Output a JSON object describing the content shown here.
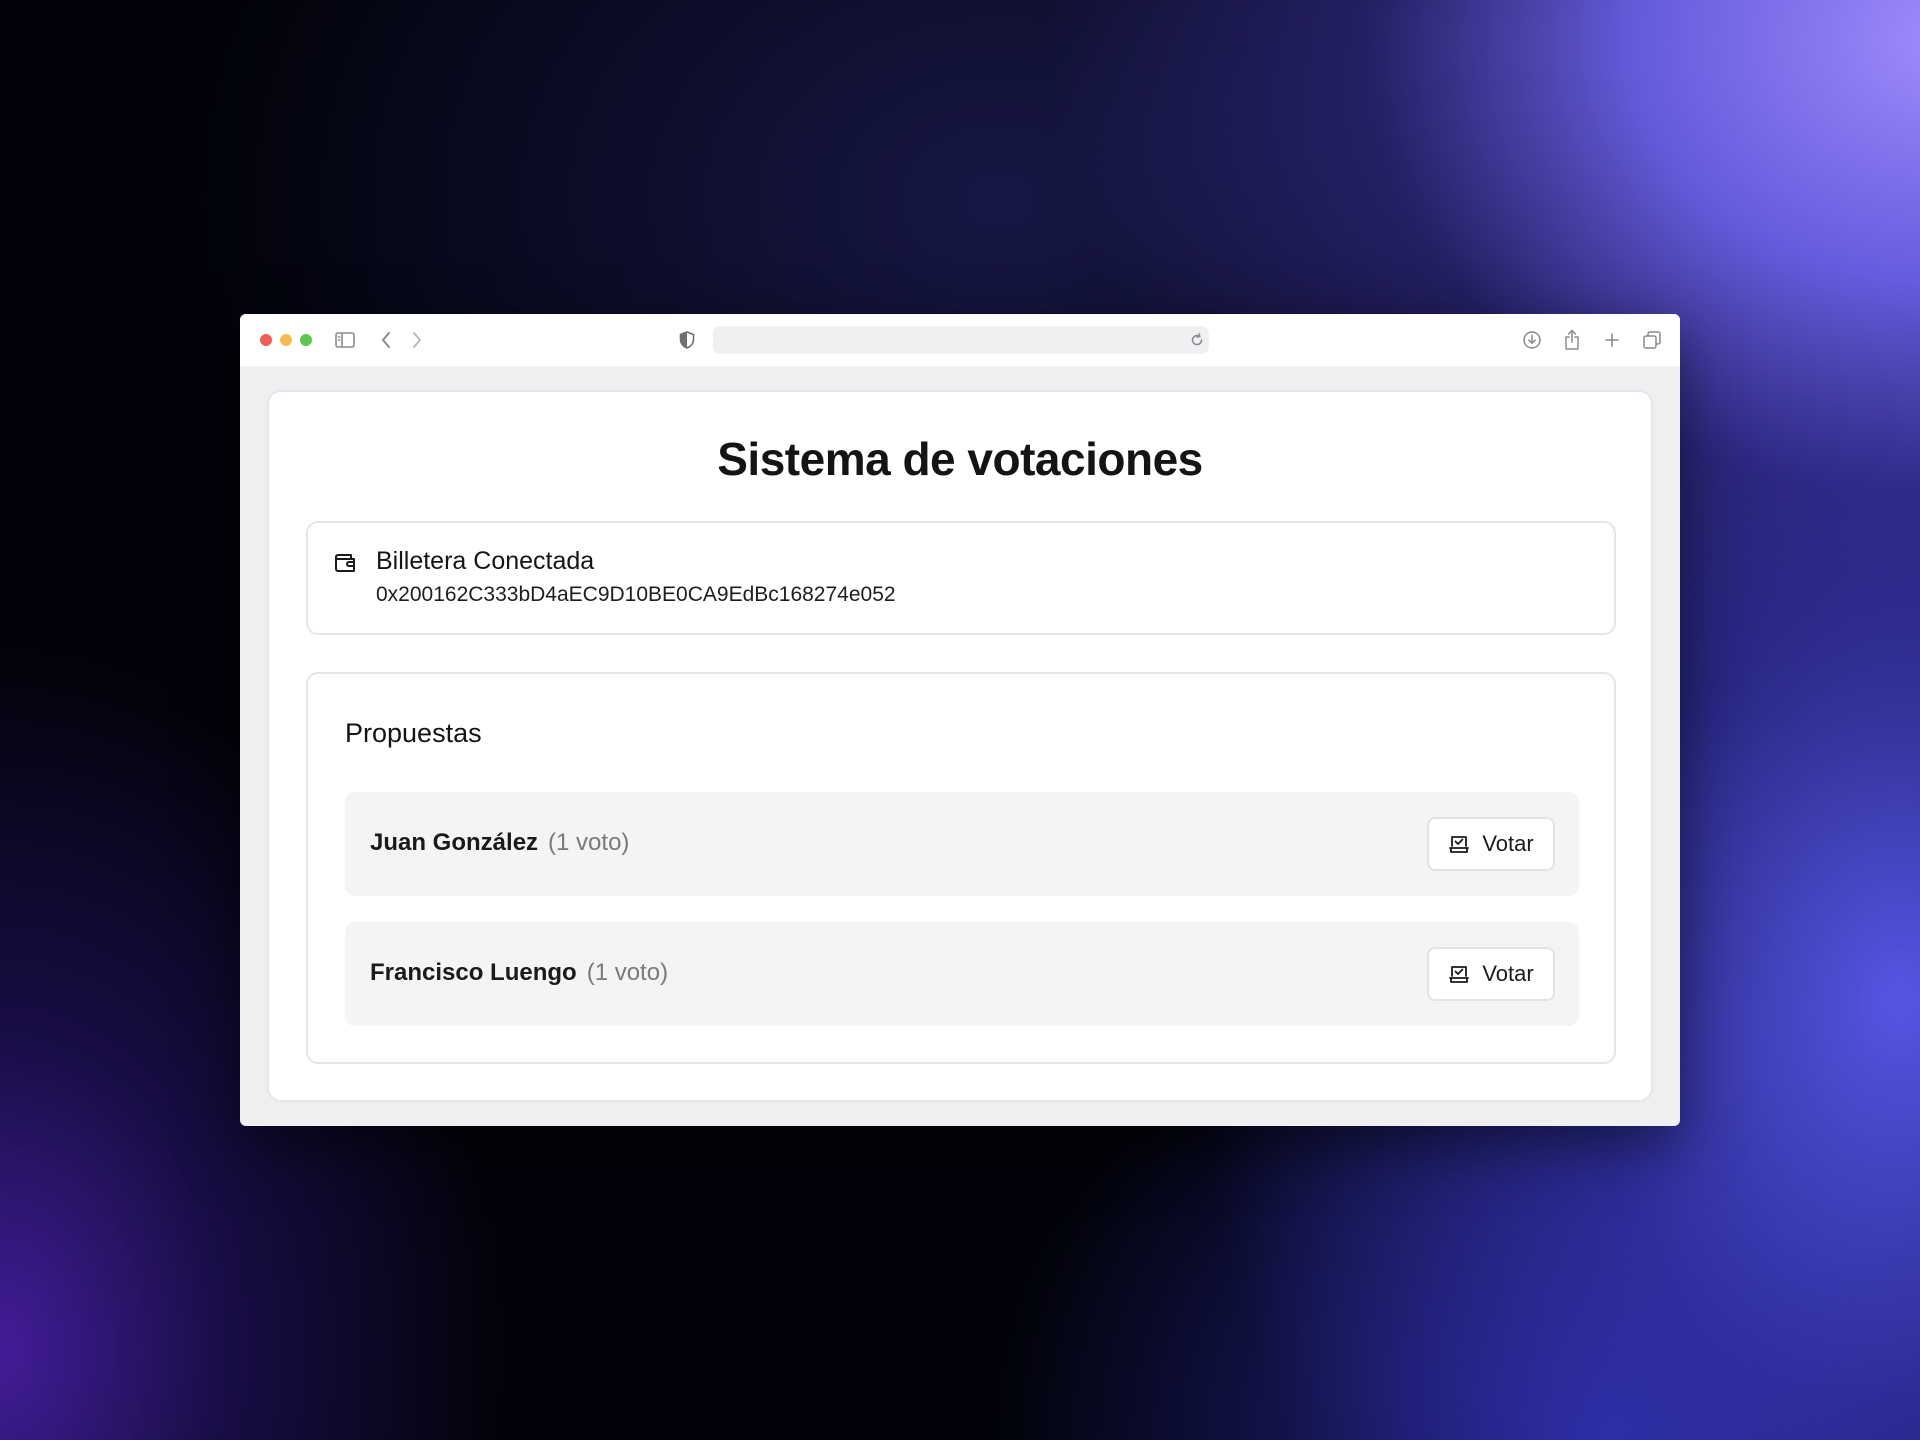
{
  "browser": {
    "traffic_lights": [
      "#ee5f57",
      "#f5bd4f",
      "#5fc454"
    ],
    "icons": {
      "sidebar": "sidebar-icon",
      "back": "chevron-left-icon",
      "forward": "chevron-right-icon",
      "privacy": "shield-icon",
      "reload": "reload-icon",
      "download": "download-icon",
      "share": "share-icon",
      "new_tab": "plus-icon",
      "tabs": "tabs-overview-icon"
    }
  },
  "page": {
    "title": "Sistema de votaciones"
  },
  "wallet": {
    "icon": "wallet-icon",
    "title": "Billetera Conectada",
    "address": "0x200162C333bD4aEC9D10BE0CA9EdBc168274e052"
  },
  "proposals": {
    "title": "Propuestas",
    "items": [
      {
        "name": "Juan González",
        "votes": "(1 voto)",
        "button_label": "Votar",
        "button_icon": "ballot-box-icon"
      },
      {
        "name": "Francisco Luengo",
        "votes": "(1 voto)",
        "button_label": "Votar",
        "button_icon": "ballot-box-icon"
      }
    ]
  }
}
